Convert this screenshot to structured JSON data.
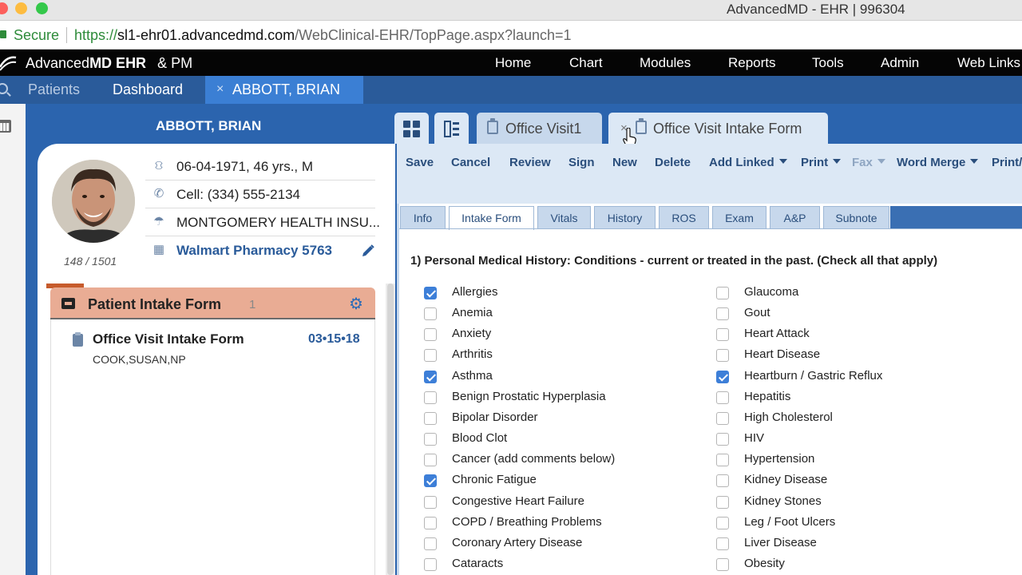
{
  "window": {
    "title": "AdvancedMD - EHR | 996304"
  },
  "address": {
    "secure_label": "Secure",
    "url_scheme": "https://",
    "url_host": "sl1-ehr01.advancedmd.com",
    "url_path": "/WebClinical-EHR/TopPage.aspx?launch=1"
  },
  "nav": {
    "logo_prefix": "Advanced",
    "logo_md": "MD EHR",
    "logo_amp": "&  PM",
    "items": [
      "Home",
      "Chart",
      "Modules",
      "Reports",
      "Tools",
      "Admin",
      "Web Links"
    ]
  },
  "patient_tabs": {
    "patients": "Patients",
    "dashboard": "Dashboard",
    "active_close": "×",
    "active": "ABBOTT, BRIAN"
  },
  "patient": {
    "name": "ABBOTT, BRIAN",
    "dob": "06-04-1971, 46 yrs., M",
    "cell": "Cell: (334) 555-2134",
    "insurance": "MONTGOMERY HEALTH INSU...",
    "pharmacy": "Walmart Pharmacy 5763",
    "counter": "148 / 1501"
  },
  "intake_panel": {
    "title": "Patient Intake Form",
    "count": "1",
    "item_title": "Office Visit Intake Form",
    "item_date": "03•15•18",
    "item_author": "COOK,SUSAN,NP"
  },
  "doc_tabs": [
    {
      "label": "Office Visit1"
    },
    {
      "label": "Office Visit Intake Form",
      "close": "×"
    }
  ],
  "toolbar": {
    "save": "Save",
    "cancel": "Cancel",
    "review": "Review",
    "sign": "Sign",
    "new": "New",
    "delete": "Delete",
    "add_linked": "Add Linked",
    "print": "Print",
    "fax": "Fax",
    "word_merge": "Word Merge",
    "print2": "Print/"
  },
  "subtabs": [
    "Info",
    "Intake Form",
    "Vitals",
    "History",
    "ROS",
    "Exam",
    "A&P",
    "Subnote"
  ],
  "active_subtab": "Intake Form",
  "form": {
    "question": "1) Personal Medical History: Conditions - current or treated in the past. (Check all that apply)",
    "left": [
      {
        "label": "Allergies",
        "checked": true
      },
      {
        "label": "Anemia",
        "checked": false
      },
      {
        "label": "Anxiety",
        "checked": false
      },
      {
        "label": "Arthritis",
        "checked": false
      },
      {
        "label": "Asthma",
        "checked": true
      },
      {
        "label": "Benign Prostatic Hyperplasia",
        "checked": false
      },
      {
        "label": "Bipolar Disorder",
        "checked": false
      },
      {
        "label": "Blood Clot",
        "checked": false
      },
      {
        "label": "Cancer (add comments below)",
        "checked": false
      },
      {
        "label": "Chronic Fatigue",
        "checked": true
      },
      {
        "label": "Congestive Heart Failure",
        "checked": false
      },
      {
        "label": "COPD / Breathing Problems",
        "checked": false
      },
      {
        "label": "Coronary Artery Disease",
        "checked": false
      },
      {
        "label": "Cataracts",
        "checked": false
      }
    ],
    "right": [
      {
        "label": "Glaucoma",
        "checked": false
      },
      {
        "label": "Gout",
        "checked": false
      },
      {
        "label": "Heart Attack",
        "checked": false
      },
      {
        "label": "Heart Disease",
        "checked": false
      },
      {
        "label": "Heartburn / Gastric Reflux",
        "checked": true
      },
      {
        "label": "Hepatitis",
        "checked": false
      },
      {
        "label": "High Cholesterol",
        "checked": false
      },
      {
        "label": "HIV",
        "checked": false
      },
      {
        "label": "Hypertension",
        "checked": false
      },
      {
        "label": "Kidney Disease",
        "checked": false
      },
      {
        "label": "Kidney Stones",
        "checked": false
      },
      {
        "label": "Leg / Foot Ulcers",
        "checked": false
      },
      {
        "label": "Liver Disease",
        "checked": false
      },
      {
        "label": "Obesity",
        "checked": false
      }
    ]
  },
  "colors": {
    "brand_blue": "#2b64ae",
    "active_tab": "#3b7fd4",
    "intake_header": "#e9ac94",
    "checkbox_checked": "#3d7fd8"
  }
}
